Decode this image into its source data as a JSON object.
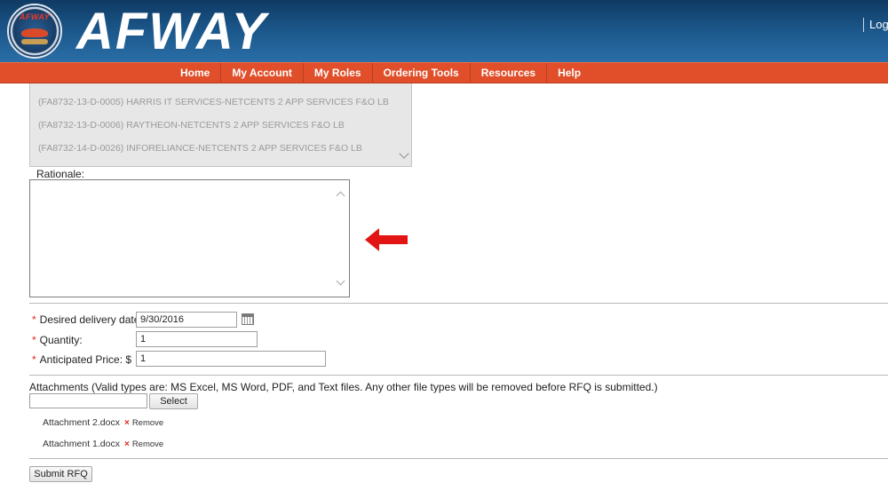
{
  "header": {
    "seal_text": "AFWAY",
    "brand": "AFWAY",
    "login_label": "Log"
  },
  "nav": {
    "items": [
      {
        "label": "Home"
      },
      {
        "label": "My Account"
      },
      {
        "label": "My Roles"
      },
      {
        "label": "Ordering Tools"
      },
      {
        "label": "Resources"
      },
      {
        "label": "Help"
      }
    ]
  },
  "contracts": {
    "items": [
      "(FA8732-13-D-0005) HARRIS IT SERVICES-NETCENTS 2 APP SERVICES F&O LB",
      "(FA8732-13-D-0006) RAYTHEON-NETCENTS 2 APP SERVICES F&O LB",
      "(FA8732-14-D-0026) INFORELIANCE-NETCENTS 2 APP SERVICES F&O LB"
    ]
  },
  "form": {
    "rationale_label": "Rationale:",
    "rationale_value": "",
    "required_mark": "*",
    "delivery_label": "Desired delivery date:",
    "delivery_value": "9/30/2016",
    "quantity_label": "Quantity:",
    "quantity_value": "1",
    "price_label": "Anticipated Price: $",
    "price_value": "1",
    "attachments_label": "Attachments (Valid types are: MS Excel, MS Word, PDF, and Text files. Any other file types will be removed before RFQ is submitted.)",
    "file_value": "",
    "select_label": "Select",
    "attachments": [
      {
        "name": "Attachment 2.docx",
        "remove": "Remove",
        "x": "×"
      },
      {
        "name": "Attachment 1.docx",
        "remove": "Remove",
        "x": "×"
      }
    ],
    "submit_label": "Submit RFQ"
  },
  "colors": {
    "header": "#1a5588",
    "nav": "#e04f2a",
    "arrow": "#e31414",
    "required": "#e0281c"
  },
  "icons": {
    "seal": "afway-seal-icon",
    "calendar": "calendar-icon",
    "arrow": "red-left-arrow-icon",
    "remove": "remove-x-icon"
  }
}
